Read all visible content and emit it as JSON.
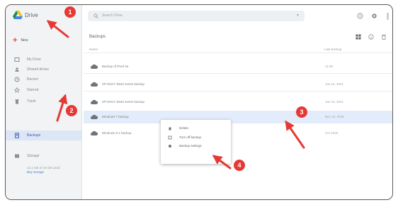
{
  "app": {
    "title": "Drive"
  },
  "sidebar": {
    "new_label": "New",
    "items": [
      {
        "label": "My Drive"
      },
      {
        "label": "Shared drives"
      },
      {
        "label": "Recent"
      },
      {
        "label": "Starred"
      },
      {
        "label": "Trash"
      },
      {
        "label": "Backups"
      },
      {
        "label": "Storage"
      }
    ],
    "storage_text": "12.1 GB of 15 GB used",
    "storage_link": "Buy storage"
  },
  "search": {
    "placeholder": "Search Drive"
  },
  "main": {
    "title": "Backups",
    "columns": {
      "name": "Name",
      "date": "Last backup"
    },
    "rows": [
      {
        "name": "Backup of Pixel 4a",
        "date": "11:09",
        "selected": false
      },
      {
        "name": "HP ENVY 5540 series backup",
        "date": "Jan 10, 2021",
        "selected": false
      },
      {
        "name": "HP ENVY 5540 series backup",
        "date": "Jan 10, 2021",
        "selected": false
      },
      {
        "name": "Windows 7 backup",
        "date": "Dec 10, 2019",
        "selected": true
      },
      {
        "name": "Windows 8.1 backup",
        "date": "Oct 2019",
        "selected": false
      }
    ]
  },
  "context_menu": {
    "items": [
      {
        "label": "Delete"
      },
      {
        "label": "Turn off backup"
      },
      {
        "label": "Backup settings"
      }
    ]
  },
  "badges": [
    "1",
    "2",
    "3",
    "4"
  ],
  "colors": {
    "accent": "#e53935",
    "selected": "#e3ecfa",
    "nav_selected": "#dde6f7",
    "link": "#4a7bd6"
  }
}
